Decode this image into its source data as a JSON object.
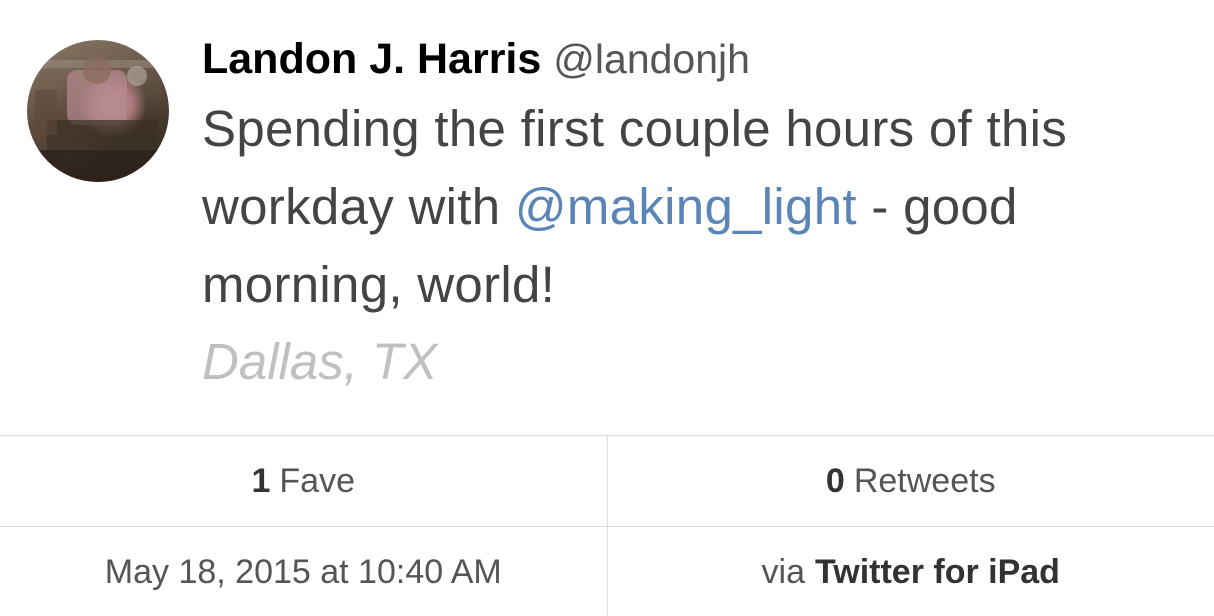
{
  "tweet": {
    "display_name": "Landon J. Harris",
    "handle": "@landonjh",
    "text_before": "Spending the first couple hours of this workday with ",
    "mention": "@making_light",
    "text_after": " - good morning, world!",
    "location": "Dallas, TX"
  },
  "stats": {
    "faves_count": "1",
    "faves_label": "Fave",
    "retweets_count": "0",
    "retweets_label": "Retweets"
  },
  "meta": {
    "timestamp": "May 18, 2015 at 10:40 AM",
    "via_prefix": "via",
    "client": "Twitter for iPad"
  },
  "colors": {
    "mention": "#5a85b8",
    "text": "#444444",
    "location": "#c0c0c0",
    "divider": "#dcdcdc"
  }
}
